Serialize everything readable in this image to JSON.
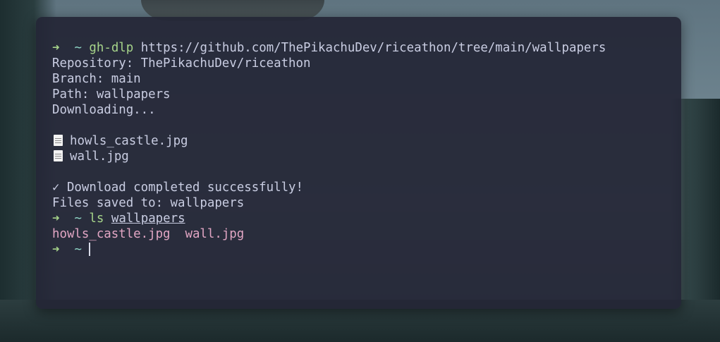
{
  "terminal": {
    "prompt_symbol": "➜",
    "cwd": "~",
    "lines": {
      "cmd1_name": "gh-dlp",
      "cmd1_url": "https://github.com/ThePikachuDev/riceathon/tree/main/wallpapers",
      "repository": "Repository: ThePikachuDev/riceathon",
      "branch": "Branch: main",
      "path": "Path: wallpapers",
      "downloading": "Downloading...",
      "file1": "howls_castle.jpg",
      "file2": "wall.jpg",
      "success": "✓ Download completed successfully!",
      "saved_to": "Files saved to: wallpapers",
      "cmd2_name": "ls",
      "cmd2_arg": "wallpapers",
      "ls_output_1": "howls_castle.jpg",
      "ls_output_2": "wall.jpg"
    }
  },
  "colors": {
    "prompt_arrow": "#a6d48a",
    "tilde": "#8fd6c6",
    "command": "#a6d48a",
    "text": "#c9cde2",
    "ls_files": "#e2a6c4",
    "terminal_bg": "#242636"
  },
  "icons": {
    "file": "document-icon"
  }
}
